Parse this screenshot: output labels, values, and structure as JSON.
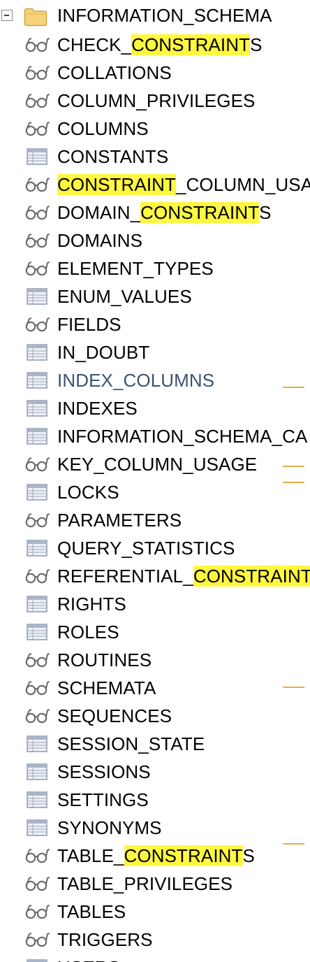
{
  "tree": {
    "root": {
      "label": "INFORMATION_SCHEMA",
      "icon": "folder-icon",
      "expanded": true
    },
    "items": [
      {
        "name": "check-constraints",
        "icon": "view-icon",
        "pre": "CHECK_",
        "hl": "CONSTRAINT",
        "post": "S"
      },
      {
        "name": "collations",
        "icon": "view-icon",
        "pre": "COLLATIONS",
        "hl": "",
        "post": ""
      },
      {
        "name": "column-privileges",
        "icon": "view-icon",
        "pre": "COLUMN_PRIVILEGES",
        "hl": "",
        "post": ""
      },
      {
        "name": "columns",
        "icon": "view-icon",
        "pre": "COLUMNS",
        "hl": "",
        "post": ""
      },
      {
        "name": "constants",
        "icon": "table-icon",
        "pre": "CONSTANTS",
        "hl": "",
        "post": ""
      },
      {
        "name": "constraint-column-usage",
        "icon": "view-icon",
        "pre": "",
        "hl": "CONSTRAINT",
        "post": "_COLUMN_USA"
      },
      {
        "name": "domain-constraints",
        "icon": "view-icon",
        "pre": "DOMAIN_",
        "hl": "CONSTRAINT",
        "post": "S"
      },
      {
        "name": "domains",
        "icon": "view-icon",
        "pre": "DOMAINS",
        "hl": "",
        "post": ""
      },
      {
        "name": "element-types",
        "icon": "view-icon",
        "pre": "ELEMENT_TYPES",
        "hl": "",
        "post": ""
      },
      {
        "name": "enum-values",
        "icon": "table-icon",
        "pre": "ENUM_VALUES",
        "hl": "",
        "post": ""
      },
      {
        "name": "fields",
        "icon": "view-icon",
        "pre": "FIELDS",
        "hl": "",
        "post": ""
      },
      {
        "name": "in-doubt",
        "icon": "table-icon",
        "pre": "IN_DOUBT",
        "hl": "",
        "post": ""
      },
      {
        "name": "index-columns",
        "icon": "table-icon",
        "pre": "INDEX_COLUMNS",
        "hl": "",
        "post": "",
        "selected": true
      },
      {
        "name": "indexes",
        "icon": "table-icon",
        "pre": "INDEXES",
        "hl": "",
        "post": ""
      },
      {
        "name": "information-schema-catalog",
        "icon": "table-icon",
        "pre": "INFORMATION_SCHEMA_CA",
        "hl": "",
        "post": ""
      },
      {
        "name": "key-column-usage",
        "icon": "view-icon",
        "pre": "KEY_COLUMN_USAGE",
        "hl": "",
        "post": ""
      },
      {
        "name": "locks",
        "icon": "table-icon",
        "pre": "LOCKS",
        "hl": "",
        "post": ""
      },
      {
        "name": "parameters",
        "icon": "view-icon",
        "pre": "PARAMETERS",
        "hl": "",
        "post": ""
      },
      {
        "name": "query-statistics",
        "icon": "table-icon",
        "pre": "QUERY_STATISTICS",
        "hl": "",
        "post": ""
      },
      {
        "name": "referential-constraints",
        "icon": "view-icon",
        "pre": "REFERENTIAL_",
        "hl": "CONSTRAINT",
        "post": ""
      },
      {
        "name": "rights",
        "icon": "table-icon",
        "pre": "RIGHTS",
        "hl": "",
        "post": ""
      },
      {
        "name": "roles",
        "icon": "table-icon",
        "pre": "ROLES",
        "hl": "",
        "post": ""
      },
      {
        "name": "routines",
        "icon": "view-icon",
        "pre": "ROUTINES",
        "hl": "",
        "post": ""
      },
      {
        "name": "schemata",
        "icon": "view-icon",
        "pre": "SCHEMATA",
        "hl": "",
        "post": ""
      },
      {
        "name": "sequences",
        "icon": "view-icon",
        "pre": "SEQUENCES",
        "hl": "",
        "post": ""
      },
      {
        "name": "session-state",
        "icon": "table-icon",
        "pre": "SESSION_STATE",
        "hl": "",
        "post": ""
      },
      {
        "name": "sessions",
        "icon": "table-icon",
        "pre": "SESSIONS",
        "hl": "",
        "post": ""
      },
      {
        "name": "settings",
        "icon": "table-icon",
        "pre": "SETTINGS",
        "hl": "",
        "post": ""
      },
      {
        "name": "synonyms",
        "icon": "table-icon",
        "pre": "SYNONYMS",
        "hl": "",
        "post": ""
      },
      {
        "name": "table-constraints",
        "icon": "view-icon",
        "pre": "TABLE_",
        "hl": "CONSTRAINT",
        "post": "S"
      },
      {
        "name": "table-privileges",
        "icon": "view-icon",
        "pre": "TABLE_PRIVILEGES",
        "hl": "",
        "post": ""
      },
      {
        "name": "tables",
        "icon": "view-icon",
        "pre": "TABLES",
        "hl": "",
        "post": ""
      },
      {
        "name": "triggers",
        "icon": "view-icon",
        "pre": "TRIGGERS",
        "hl": "",
        "post": ""
      },
      {
        "name": "users",
        "icon": "table-icon",
        "pre": "USERS",
        "hl": "",
        "post": ""
      }
    ]
  },
  "colors": {
    "search_highlight": "#fff740",
    "selected_text": "#3d5270",
    "overview_marker": "#e0b048"
  }
}
